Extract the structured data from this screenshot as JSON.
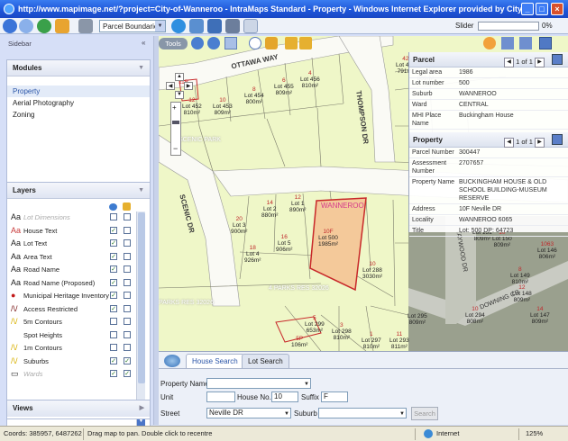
{
  "window": {
    "title": "http://www.mapimage.net/?project=City-of-Wanneroo - IntraMaps Standard - Property - Windows Internet Explorer provided by City"
  },
  "toolbar": {
    "layer_select": "Parcel Boundaries",
    "slider_label": "Slider",
    "slider_percent": "0%",
    "slider_value": 0
  },
  "sidebar": {
    "label": "Sidebar",
    "collapse": "«",
    "modules": {
      "title": "Modules",
      "items": [
        "Property",
        "Aerial Photography",
        "Zoning"
      ]
    },
    "layers": {
      "title": "Layers",
      "items": [
        {
          "sym": "Aa",
          "label": "Lot Dimensions",
          "visible": false,
          "active": false,
          "dim": true
        },
        {
          "sym": "Aa",
          "label": "House Text",
          "visible": true,
          "active": false
        },
        {
          "sym": "Aa",
          "label": "Lot Text",
          "visible": true,
          "active": false
        },
        {
          "sym": "Aa",
          "label": "Area Text",
          "visible": true,
          "active": false
        },
        {
          "sym": "Aa",
          "label": "Road Name",
          "visible": true,
          "active": false
        },
        {
          "sym": "Aa",
          "label": "Road Name (Proposed)",
          "visible": true,
          "active": false
        },
        {
          "sym": "●",
          "label": "Municipal Heritage Inventory",
          "visible": true,
          "active": false
        },
        {
          "sym": "/\\/",
          "label": "Access Restricted",
          "visible": true,
          "active": false
        },
        {
          "sym": "/\\/",
          "label": "5m Contours",
          "visible": false,
          "active": false
        },
        {
          "sym": "",
          "label": "Spot Heights",
          "visible": false,
          "active": false
        },
        {
          "sym": "/\\/",
          "label": "1m Contours",
          "visible": false,
          "active": false
        },
        {
          "sym": "/\\/",
          "label": "Suburbs",
          "visible": true,
          "active": true
        },
        {
          "sym": "▭",
          "label": "Wards",
          "visible": true,
          "active": true,
          "dim": true
        }
      ]
    },
    "views": {
      "title": "Views"
    }
  },
  "map": {
    "tools_label": "Tools",
    "roads": [
      "OTTAWA WAY",
      "THOMPSON DR",
      "SCENIC DR",
      "TAYWOOD DR",
      "DOWNING CR"
    ],
    "park_labels": [
      "SCENIC PARK",
      "4 PARKS RES 32026",
      "PARKS RES 32026"
    ],
    "suburb_label": "WANNEROO",
    "lots": [
      {
        "n": "42",
        "lot": "Lot 457",
        "area": "791m²"
      },
      {
        "n": "43",
        "lot": "Lot 456",
        "area": "809m²"
      },
      {
        "n": "4",
        "lot": "Lot 456",
        "area": "810m²"
      },
      {
        "n": "6",
        "lot": "Lot 455",
        "area": "809m²"
      },
      {
        "n": "8",
        "lot": "Lot 454",
        "area": "800m²"
      },
      {
        "n": "10",
        "lot": "Lot 453",
        "area": "809m²"
      },
      {
        "n": "12",
        "lot": "Lot 452",
        "area": "810m²"
      },
      {
        "n": "11B",
        "lot": "",
        "area": ""
      },
      {
        "n": "14",
        "lot": "Lot 2",
        "area": "880m²"
      },
      {
        "n": "12",
        "lot": "Lot 1",
        "area": "890m²"
      },
      {
        "n": "20",
        "lot": "Lot 3",
        "area": "900m²"
      },
      {
        "n": "16",
        "lot": "Lot 5",
        "area": "906m²"
      },
      {
        "n": "18",
        "lot": "Lot 4",
        "area": "926m²"
      },
      {
        "n": "10F",
        "lot": "Lot 500",
        "area": "1985m²"
      },
      {
        "n": "10",
        "lot": "Lot 288",
        "area": "3030m²"
      },
      {
        "n": "5",
        "lot": "Lot 299",
        "area": "653m²"
      },
      {
        "n": "3",
        "lot": "Lot 298",
        "area": "810m²"
      },
      {
        "n": "1",
        "lot": "Lot 297",
        "area": "810m²"
      },
      {
        "n": "5P",
        "lot": "",
        "area": "106m²"
      },
      {
        "n": "1",
        "lot": "Lot 151",
        "area": "809m²"
      },
      {
        "n": "10",
        "lot": "Lot 150",
        "area": "809m²"
      },
      {
        "n": "1063",
        "lot": "Lot 146",
        "area": "806m²"
      },
      {
        "n": "8",
        "lot": "Lot 149",
        "area": "810m²"
      },
      {
        "n": "12",
        "lot": "Lot 148",
        "area": "809m²"
      },
      {
        "n": "14",
        "lot": "Lot 147",
        "area": "809m²"
      },
      {
        "n": "10",
        "lot": "Lot 294",
        "area": "808m²"
      },
      {
        "n": "",
        "lot": "Lot 295",
        "area": "809m²"
      },
      {
        "n": "11",
        "lot": "Lot 293",
        "area": "811m²"
      }
    ]
  },
  "parcel": {
    "title": "Parcel",
    "pager": "1 of 1",
    "rows": [
      {
        "k": "Legal area",
        "v": "1986"
      },
      {
        "k": "Lot number",
        "v": "500"
      },
      {
        "k": "Suburb",
        "v": "WANNEROO"
      },
      {
        "k": "Ward",
        "v": "CENTRAL"
      },
      {
        "k": "MHI Place Name",
        "v": "Buckingham House"
      }
    ]
  },
  "property": {
    "title": "Property",
    "pager": "1 of 1",
    "rows": [
      {
        "k": "Parcel Number",
        "v": "300447"
      },
      {
        "k": "Assessment Number",
        "v": "2707657"
      },
      {
        "k": "Property Name",
        "v": "BUCKINGHAM HOUSE & OLD SCHOOL BUILDING-MUSEUM RESERVE"
      },
      {
        "k": "Address",
        "v": "10F Neville DR"
      },
      {
        "k": "Locality",
        "v": "WANNEROO 6065"
      },
      {
        "k": "Title",
        "v": "Lot: 500 DP: 64723"
      }
    ]
  },
  "search": {
    "tabs": [
      "House Search",
      "Lot Search"
    ],
    "property_name_label": "Property Name",
    "unit_label": "Unit",
    "house_no_label": "House No.",
    "house_no_value": "10",
    "suffix_label": "Suffix",
    "suffix_value": "F",
    "street_label": "Street",
    "street_value": "Neville DR",
    "suburb_label": "Suburb",
    "search_button": "Search"
  },
  "status": {
    "coords": "Coords: 385957, 6487262",
    "hint": "Drag map to pan. Double click to recentre",
    "zone": "Internet",
    "zoom": "125%"
  }
}
